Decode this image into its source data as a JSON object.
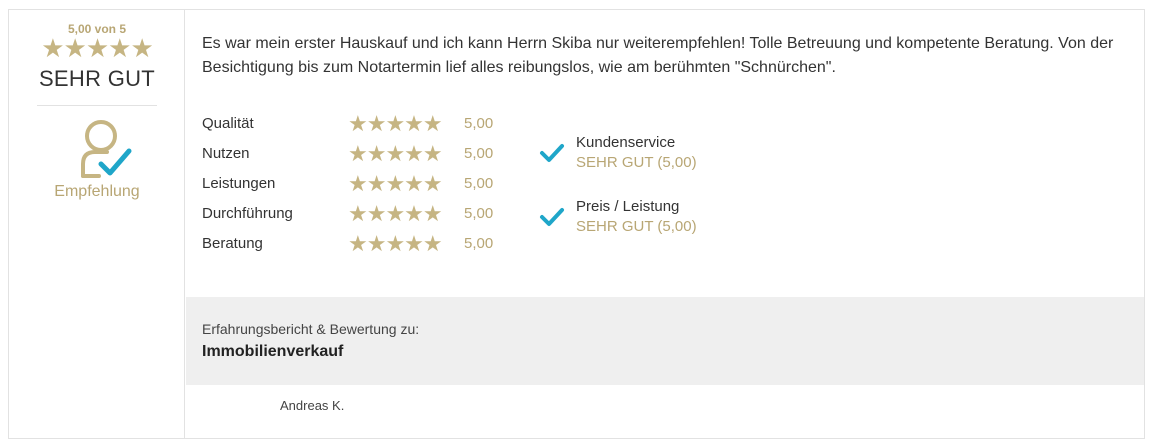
{
  "summary": {
    "score_label": "5,00 von 5",
    "stars": "★★★★★",
    "rating_word": "SEHR GUT",
    "recommendation": "Empfehlung"
  },
  "review": {
    "text": "Es war mein erster Hauskauf und ich kann Herrn Skiba nur weiterempfehlen! Tolle Betreuung und kompetente Beratung. Von der Besichtigung bis zum Notartermin lief alles reibungslos, wie am berühmten \"Schnürchen\"."
  },
  "criteria": [
    {
      "name": "Qualität",
      "stars": "★★★★★",
      "value": "5,00"
    },
    {
      "name": "Nutzen",
      "stars": "★★★★★",
      "value": "5,00"
    },
    {
      "name": "Leistungen",
      "stars": "★★★★★",
      "value": "5,00"
    },
    {
      "name": "Durchführung",
      "stars": "★★★★★",
      "value": "5,00"
    },
    {
      "name": "Beratung",
      "stars": "★★★★★",
      "value": "5,00"
    }
  ],
  "checks": [
    {
      "title": "Kundenservice",
      "rating": "SEHR GUT (5,00)",
      "icon": "checkmark-icon"
    },
    {
      "title": "Preis / Leistung",
      "rating": "SEHR GUT (5,00)",
      "icon": "checkmark-icon"
    }
  ],
  "footer": {
    "caption": "Erfahrungsbericht & Bewertung zu:",
    "category": "Immobilienverkauf"
  },
  "author": "Andreas K.",
  "colors": {
    "gold": "#c6b583",
    "gold_text": "#b8a674",
    "check": "#1fa6c9",
    "footer_bg": "#efefef"
  }
}
